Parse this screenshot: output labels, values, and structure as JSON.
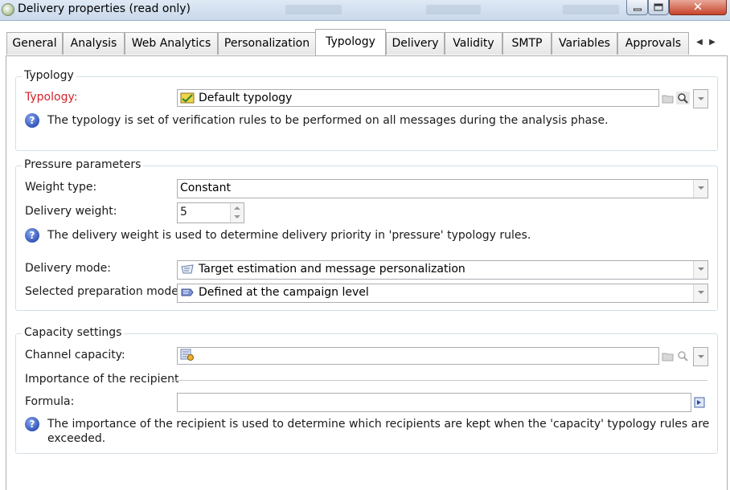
{
  "window": {
    "title": "Delivery properties (read only)",
    "controls": {
      "minimize": "",
      "maximize": "",
      "close": "✕"
    }
  },
  "tabs": [
    {
      "label": "General"
    },
    {
      "label": "Analysis"
    },
    {
      "label": "Web Analytics"
    },
    {
      "label": "Personalization"
    },
    {
      "label": "Typology"
    },
    {
      "label": "Delivery"
    },
    {
      "label": "Validity"
    },
    {
      "label": "SMTP"
    },
    {
      "label": "Variables"
    },
    {
      "label": "Approvals"
    }
  ],
  "active_tab": "Typology",
  "tab_scroll": {
    "left": "◀",
    "right": "▶"
  },
  "typology_group": {
    "legend": "Typology",
    "typology_label": "Typology:",
    "typology_value": "Default typology",
    "info_icon": "?",
    "info_text": "The typology is set of verification rules to be performed on all messages during the analysis phase."
  },
  "pressure_group": {
    "legend": "Pressure parameters",
    "weight_type_label": "Weight type:",
    "weight_type_value": "Constant",
    "delivery_weight_label": "Delivery weight:",
    "delivery_weight_value": "5",
    "info_icon": "?",
    "info_text": "The delivery weight is used to determine delivery priority in 'pressure' typology rules.",
    "delivery_mode_label": "Delivery mode:",
    "delivery_mode_value": "Target estimation and message personalization",
    "prep_mode_label": "Selected preparation mode:",
    "prep_mode_value": "Defined at the campaign level"
  },
  "capacity_group": {
    "legend": "Capacity settings",
    "channel_capacity_label": "Channel capacity:",
    "channel_capacity_value": "",
    "importance_heading": "Importance of the recipient",
    "formula_label": "Formula:",
    "formula_value": "",
    "info_icon": "?",
    "info_text_line1": "The importance of the recipient is used to determine which recipients are kept when the 'capacity' typology rules are",
    "info_text_line2": "exceeded."
  },
  "colors": {
    "required_label": "#d2232a",
    "info_icon": "#3356b8",
    "group_border": "#d5dfe5"
  }
}
